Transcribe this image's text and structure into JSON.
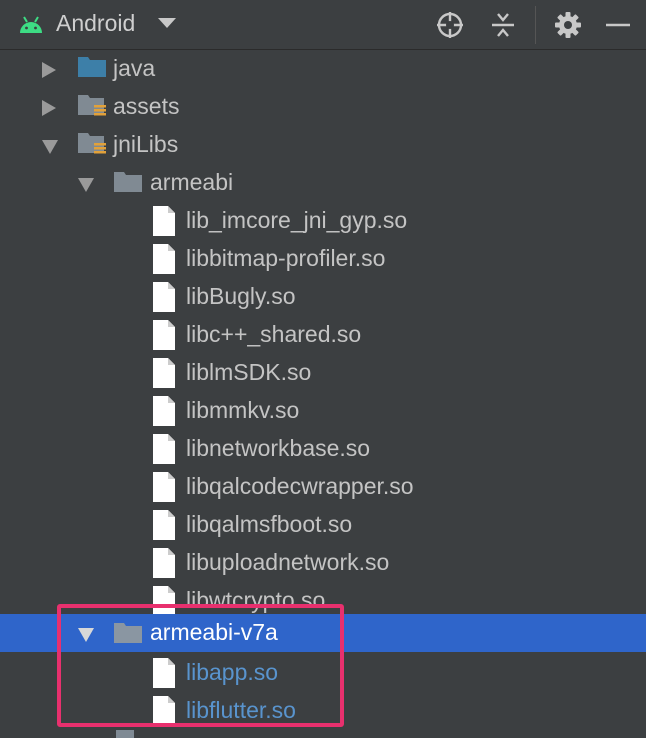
{
  "toolbar": {
    "title": "Android",
    "icons": [
      "android-logo-icon",
      "dropdown-caret-icon",
      "locate-icon",
      "collapse-all-icon",
      "gear-icon",
      "minimize-icon"
    ]
  },
  "tree": [
    {
      "label": "java",
      "type": "folder-source",
      "expanded": false
    },
    {
      "label": "assets",
      "type": "folder-resource",
      "expanded": false
    },
    {
      "label": "jniLibs",
      "type": "folder-resource",
      "expanded": true
    },
    {
      "label": "armeabi",
      "type": "folder",
      "expanded": true
    },
    {
      "label": "lib_imcore_jni_gyp.so",
      "type": "file"
    },
    {
      "label": "libbitmap-profiler.so",
      "type": "file"
    },
    {
      "label": "libBugly.so",
      "type": "file"
    },
    {
      "label": "libc++_shared.so",
      "type": "file"
    },
    {
      "label": "liblmSDK.so",
      "type": "file"
    },
    {
      "label": "libmmkv.so",
      "type": "file"
    },
    {
      "label": "libnetworkbase.so",
      "type": "file"
    },
    {
      "label": "libqalcodecwrapper.so",
      "type": "file"
    },
    {
      "label": "libqalmsfboot.so",
      "type": "file"
    },
    {
      "label": "libuploadnetwork.so",
      "type": "file"
    },
    {
      "label": "libwtcrypto.so",
      "type": "file"
    },
    {
      "label": "armeabi-v7a",
      "type": "folder",
      "expanded": true,
      "selected": true
    },
    {
      "label": "libapp.so",
      "type": "file",
      "status": "new"
    },
    {
      "label": "libflutter.so",
      "type": "file",
      "status": "new"
    }
  ],
  "colors": {
    "background": "#3c3f41",
    "selection": "#2f65ca",
    "new_file_text": "#5994ce",
    "highlight_box": "#e8306e",
    "android_green": "#3ddc84"
  }
}
